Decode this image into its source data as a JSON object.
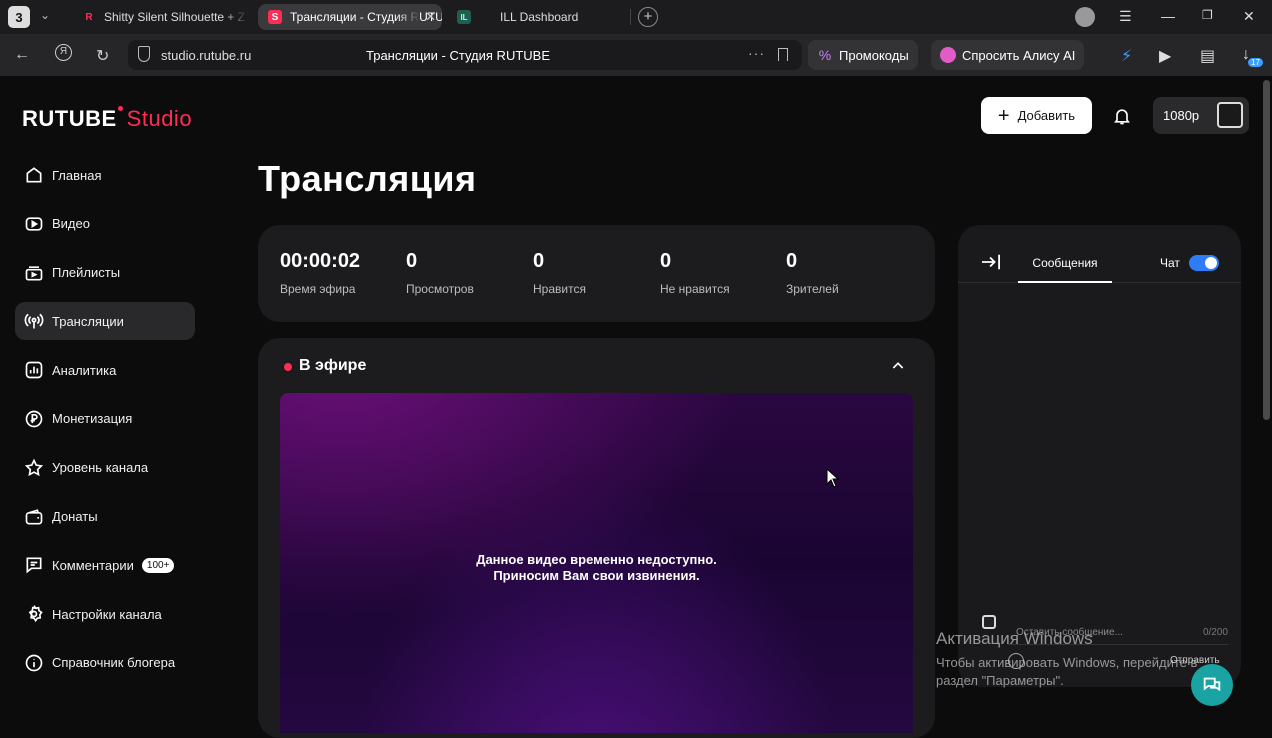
{
  "browser": {
    "tab_count": "3",
    "tabs": [
      {
        "label": "Shitty Silent Silhouette + Z",
        "favicon": "R"
      },
      {
        "label": "Трансляции - Студия RUTUBE",
        "favicon": "S"
      },
      {
        "label": "ILL Dashboard",
        "favicon": "IL"
      }
    ],
    "url": "studio.rutube.ru",
    "page_title": "Трансляции - Студия RUTUBE",
    "promo_label": "Промокоды",
    "alice_label": "Спросить Алису AI",
    "ext_badge": "17"
  },
  "header": {
    "logo_main": "RUTUBE",
    "logo_studio": "Studio",
    "add_label": "Добавить",
    "quality": "1080p"
  },
  "sidebar": {
    "items": [
      {
        "label": "Главная",
        "icon": "home-icon"
      },
      {
        "label": "Видео",
        "icon": "video-icon"
      },
      {
        "label": "Плейлисты",
        "icon": "playlist-icon"
      },
      {
        "label": "Трансляции",
        "icon": "broadcast-icon"
      },
      {
        "label": "Аналитика",
        "icon": "analytics-icon"
      },
      {
        "label": "Монетизация",
        "icon": "ruble-icon"
      },
      {
        "label": "Уровень канала",
        "icon": "star-icon"
      },
      {
        "label": "Донаты",
        "icon": "wallet-icon"
      },
      {
        "label": "Комментарии",
        "icon": "comment-icon",
        "badge": "100+"
      },
      {
        "label": "Настройки канала",
        "icon": "gear-icon"
      },
      {
        "label": "Справочник блогера",
        "icon": "info-icon"
      }
    ]
  },
  "main": {
    "title": "Трансляция",
    "stats": [
      {
        "value": "00:00:02",
        "label": "Время эфира"
      },
      {
        "value": "0",
        "label": "Просмотров"
      },
      {
        "value": "0",
        "label": "Нравится"
      },
      {
        "value": "0",
        "label": "Не нравится"
      },
      {
        "value": "0",
        "label": "Зрителей"
      }
    ],
    "live_title": "В эфире",
    "player_line1": "Данное видео временно недоступно.",
    "player_line2": "Приносим Вам свои извинения."
  },
  "chat": {
    "tab_label": "Сообщения",
    "toggle_label": "Чат",
    "toggle_on": true,
    "placeholder": "Оставить сообщение...",
    "counter": "0/200",
    "send_label": "Отправить"
  },
  "windows_watermark": {
    "title": "Активация Windows",
    "line1": "Чтобы активировать Windows, перейдите в",
    "line2": "раздел \"Параметры\"."
  },
  "colors": {
    "accent": "#ff2d55",
    "toggle": "#2e7cf6",
    "help": "#1aa3a3"
  }
}
